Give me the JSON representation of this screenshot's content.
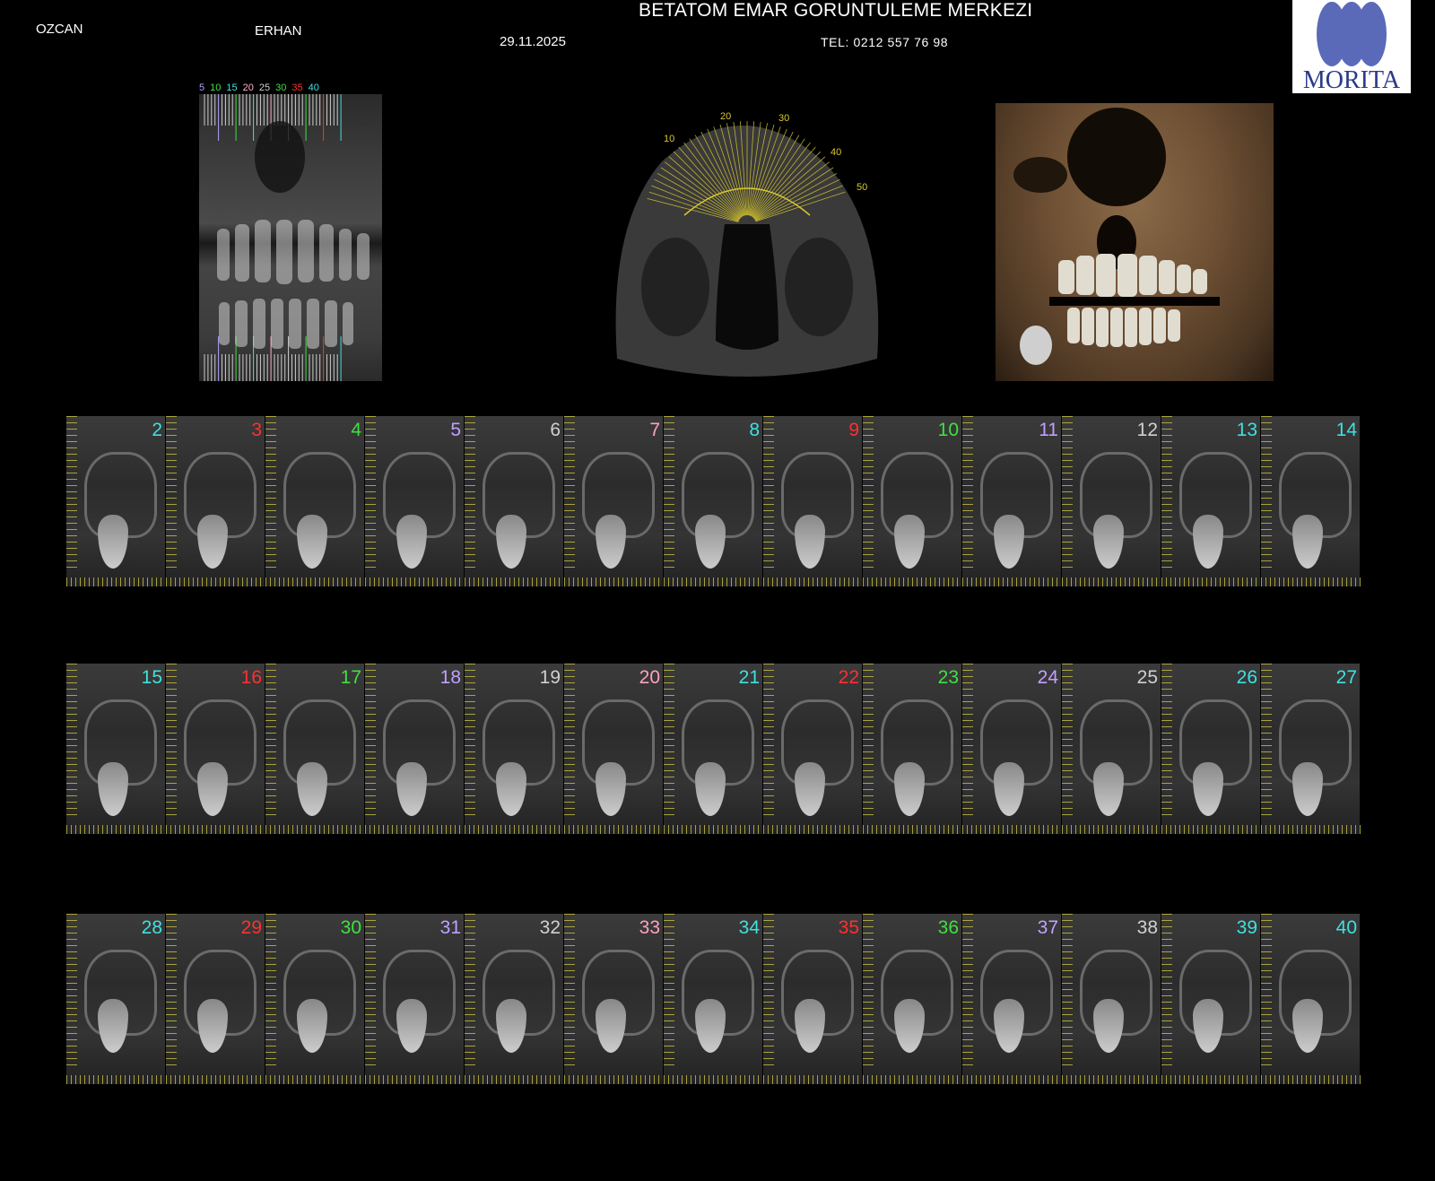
{
  "header": {
    "name_first": "OZCAN",
    "name_second": "ERHAN",
    "date": "29.11.2025",
    "title": "BETATOM EMAR GORUNTULEME MERKEZI",
    "tel": "TEL: 0212 557 76 98"
  },
  "logo": {
    "text": "MORITA",
    "color": "#5a6ab8",
    "text_color": "#2a3a8a"
  },
  "panorama_scale": [
    {
      "label": "5",
      "color": "#b0a0ff"
    },
    {
      "label": "10",
      "color": "#40e040"
    },
    {
      "label": "15",
      "color": "#40e0e0"
    },
    {
      "label": "20",
      "color": "#ffb0d0"
    },
    {
      "label": "25",
      "color": "#d0d0d0"
    },
    {
      "label": "30",
      "color": "#40e040"
    },
    {
      "label": "35",
      "color": "#ff3030"
    },
    {
      "label": "40",
      "color": "#40e0e0"
    }
  ],
  "axial_scale": [
    "10",
    "20",
    "30",
    "40",
    "50"
  ],
  "slice_color_cycle": [
    "#40e0e0",
    "#ff3030",
    "#40e040",
    "#c0a0ff",
    "#d0d0d0",
    "#ffa0c0"
  ],
  "rows": [
    {
      "slices": [
        {
          "n": "2",
          "c": "#40e0e0"
        },
        {
          "n": "3",
          "c": "#ff3030"
        },
        {
          "n": "4",
          "c": "#40e040"
        },
        {
          "n": "5",
          "c": "#c0a0ff"
        },
        {
          "n": "6",
          "c": "#d0d0d0"
        },
        {
          "n": "7",
          "c": "#ffa0c0"
        },
        {
          "n": "8",
          "c": "#40e0e0"
        },
        {
          "n": "9",
          "c": "#ff3030"
        },
        {
          "n": "10",
          "c": "#40e040"
        },
        {
          "n": "11",
          "c": "#c0a0ff"
        },
        {
          "n": "12",
          "c": "#d0d0d0"
        },
        {
          "n": "13",
          "c": "#40e0e0"
        },
        {
          "n": "14",
          "c": "#40e0e0"
        }
      ]
    },
    {
      "slices": [
        {
          "n": "15",
          "c": "#40e0e0"
        },
        {
          "n": "16",
          "c": "#ff3030"
        },
        {
          "n": "17",
          "c": "#40e040"
        },
        {
          "n": "18",
          "c": "#c0a0ff"
        },
        {
          "n": "19",
          "c": "#d0d0d0"
        },
        {
          "n": "20",
          "c": "#ffa0c0"
        },
        {
          "n": "21",
          "c": "#40e0e0"
        },
        {
          "n": "22",
          "c": "#ff3030"
        },
        {
          "n": "23",
          "c": "#40e040"
        },
        {
          "n": "24",
          "c": "#c0a0ff"
        },
        {
          "n": "25",
          "c": "#d0d0d0"
        },
        {
          "n": "26",
          "c": "#40e0e0"
        },
        {
          "n": "27",
          "c": "#40e0e0"
        }
      ]
    },
    {
      "slices": [
        {
          "n": "28",
          "c": "#40e0e0"
        },
        {
          "n": "29",
          "c": "#ff3030"
        },
        {
          "n": "30",
          "c": "#40e040"
        },
        {
          "n": "31",
          "c": "#c0a0ff"
        },
        {
          "n": "32",
          "c": "#d0d0d0"
        },
        {
          "n": "33",
          "c": "#ffa0c0"
        },
        {
          "n": "34",
          "c": "#40e0e0"
        },
        {
          "n": "35",
          "c": "#ff3030"
        },
        {
          "n": "36",
          "c": "#40e040"
        },
        {
          "n": "37",
          "c": "#c0a0ff"
        },
        {
          "n": "38",
          "c": "#d0d0d0"
        },
        {
          "n": "39",
          "c": "#40e0e0"
        },
        {
          "n": "40",
          "c": "#40e0e0"
        }
      ]
    }
  ]
}
